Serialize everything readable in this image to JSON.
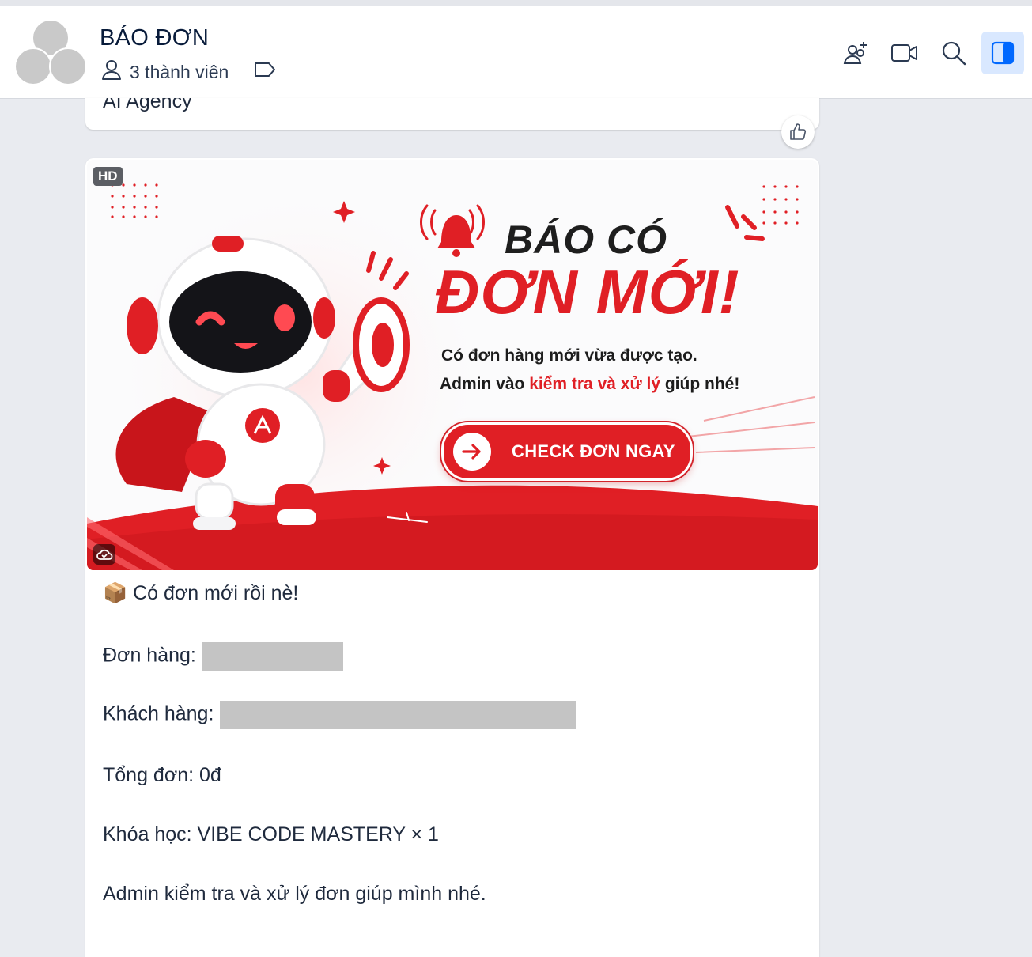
{
  "header": {
    "title": "BÁO ĐƠN",
    "members_label": "3 thành viên",
    "icons": [
      "add-member-icon",
      "video-call-icon",
      "search-icon",
      "sidebar-toggle-icon"
    ]
  },
  "previous_message": {
    "text": "AI Agency"
  },
  "banner": {
    "badge": "HD",
    "heading_top": "BÁO CÓ",
    "heading_bottom": "ĐƠN MỚI!",
    "line1": "Có đơn hàng mới vừa được tạo.",
    "line2_pre": "Admin vào ",
    "line2_red": "kiểm tra và xử lý",
    "line2_post": " giúp nhé!",
    "cta_label": "CHECK ĐƠN NGAY"
  },
  "message": {
    "intro_emoji": "📦",
    "intro": "Có đơn mới rồi nè!",
    "order_label": "Đơn hàng:",
    "customer_label": "Khách hàng:",
    "total": "Tổng đơn: 0đ",
    "course": "Khóa học: VIBE CODE MASTERY × 1",
    "closing": "Admin kiểm tra và xử lý đơn giúp mình nhé."
  },
  "colors": {
    "brand_red": "#e01f25",
    "accent_blue": "#0068ff",
    "title": "#081b3a"
  }
}
